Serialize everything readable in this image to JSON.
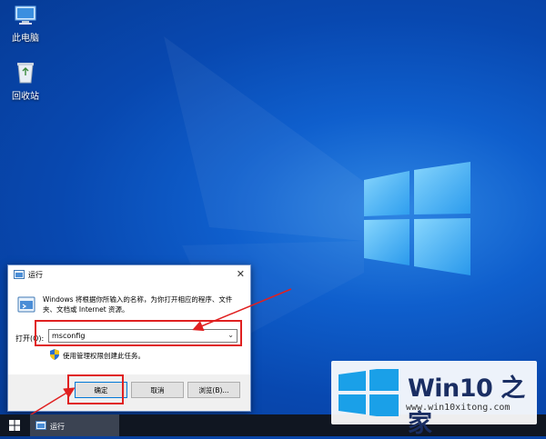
{
  "desktop": {
    "icons": [
      {
        "label": "此电脑",
        "icon": "this-pc-icon"
      },
      {
        "label": "回收站",
        "icon": "recycle-bin-icon"
      }
    ]
  },
  "run_dialog": {
    "title": "运行",
    "close_glyph": "✕",
    "description": "Windows 将根据你所输入的名称，为你打开相应的程序、文件夹、文档或 Internet 资源。",
    "open_label": "打开(O):",
    "open_value": "msconfig",
    "dropdown_glyph": "⌄",
    "admin_note": "使用管理权限创建此任务。",
    "buttons": {
      "ok": "确定",
      "cancel": "取消",
      "browse": "浏览(B)..."
    }
  },
  "taskbar": {
    "start_icon": "windows-start-icon",
    "running_app": "运行"
  },
  "watermark": {
    "brand": "Win10 之家",
    "url": "www.win10xitong.com"
  },
  "colors": {
    "highlight": "#e02020",
    "desktop_blue": "#0a56c0",
    "taskbar": "#101621"
  }
}
